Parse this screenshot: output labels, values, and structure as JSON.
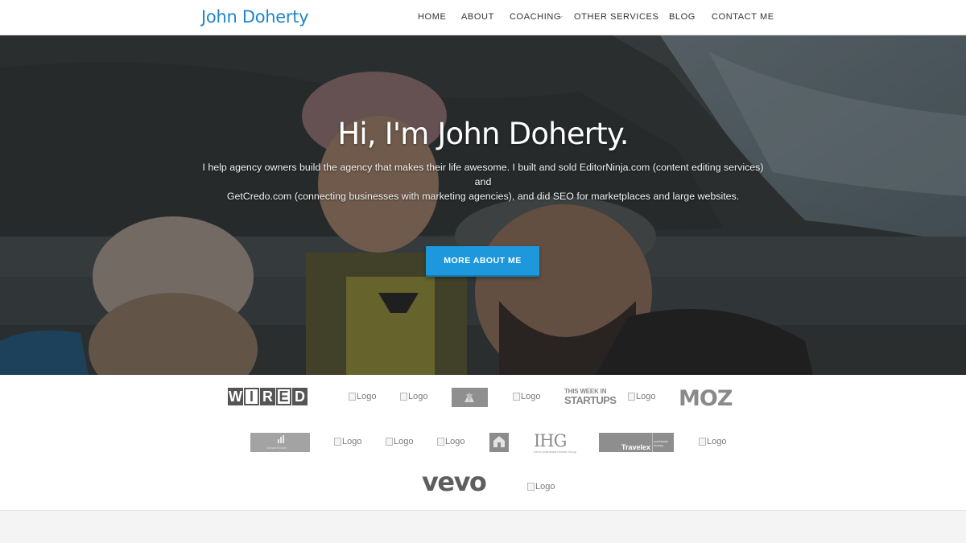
{
  "header": {
    "brand": "John Doherty",
    "nav": [
      {
        "label": "HOME",
        "has_dropdown": false
      },
      {
        "label": "ABOUT",
        "has_dropdown": false
      },
      {
        "label": "COACHING",
        "has_dropdown": true
      },
      {
        "label": "OTHER SERVICES",
        "has_dropdown": true
      },
      {
        "label": "BLOG",
        "has_dropdown": false
      },
      {
        "label": "CONTACT ME",
        "has_dropdown": false
      }
    ],
    "caret_icon": "chevron-down-icon"
  },
  "hero": {
    "title": "Hi, I'm John Doherty.",
    "subtitle_line1": "I help agency owners build the agency that makes their life awesome. I built and sold EditorNinja.com (content editing services) and",
    "subtitle_line2": "GetCredo.com (connecting businesses with marketing agencies), and did SEO for marketplaces and large websites.",
    "cta_label": "MORE ABOUT ME",
    "background_description_icon": "family-photo-image"
  },
  "logos": {
    "broken_alt": "Logo",
    "wired": [
      "W",
      "I",
      "R",
      "E",
      "D"
    ],
    "moz": "MOZ",
    "vevo": "vevo",
    "this_week_in_startups": {
      "line1": "THIS WEEK IN",
      "line2": "STARTUPS"
    },
    "ihg": "IHG",
    "ihg_sub": "InterContinental Hotels Group",
    "travelex": "Travelex",
    "travelex_sub": "worldwide money",
    "growthrocket": "GrowthRocket"
  },
  "colors": {
    "brand": "#1f86c7",
    "cta": "#1e98dc",
    "header_bg": "#ffffff",
    "page_bg": "#f4f4f5"
  }
}
